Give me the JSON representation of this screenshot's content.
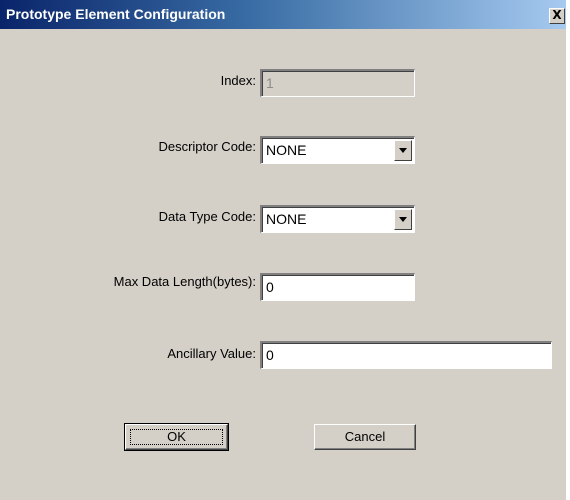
{
  "window": {
    "title": "Prototype Element Configuration",
    "close_glyph": "X"
  },
  "form": {
    "index": {
      "label": "Index:",
      "value": "1"
    },
    "descriptor_code": {
      "label": "Descriptor Code:",
      "value": "NONE"
    },
    "data_type_code": {
      "label": "Data Type Code:",
      "value": "NONE"
    },
    "max_data_length": {
      "label": "Max Data Length(bytes):",
      "value": "0"
    },
    "ancillary_value": {
      "label": "Ancillary Value:",
      "value": "0"
    }
  },
  "buttons": {
    "ok": "OK",
    "cancel": "Cancel"
  },
  "colors": {
    "dialog_bg": "#d4d0c8",
    "title_start": "#0a246a",
    "title_end": "#a6caf0"
  }
}
